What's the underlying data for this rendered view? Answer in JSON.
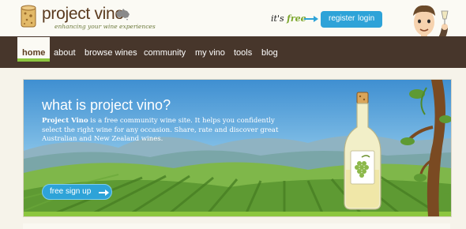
{
  "brand": {
    "name": "project vino",
    "tagline": "enhancing your wine experiences"
  },
  "header": {
    "free_prefix": "it's",
    "free_word": "free",
    "register": "register",
    "login": "login"
  },
  "nav": {
    "items": [
      {
        "label": "home",
        "active": true
      },
      {
        "label": "about"
      },
      {
        "label": "browse wines"
      },
      {
        "label": "community"
      },
      {
        "label": "my vino"
      },
      {
        "label": "tools"
      },
      {
        "label": "blog"
      }
    ]
  },
  "banner": {
    "title": "what is project vino?",
    "desc_bold": "Project Vino",
    "desc_rest": " is a free community wine site. It helps you confidently select the right wine for any occasion. Share, rate and discover great Australian and New Zealand wines.",
    "signup": "free sign up"
  },
  "colors": {
    "nav_bg": "#47362b",
    "accent_blue": "#2ea3d8",
    "accent_green": "#8cc63f",
    "brand_brown": "#5a3a1e"
  },
  "icons": [
    "wine-cork-logo-icon",
    "australia-map-icon",
    "arrow-right-icon",
    "wine-bottle-illustration",
    "vine-tree-illustration",
    "mascot-illustration"
  ]
}
